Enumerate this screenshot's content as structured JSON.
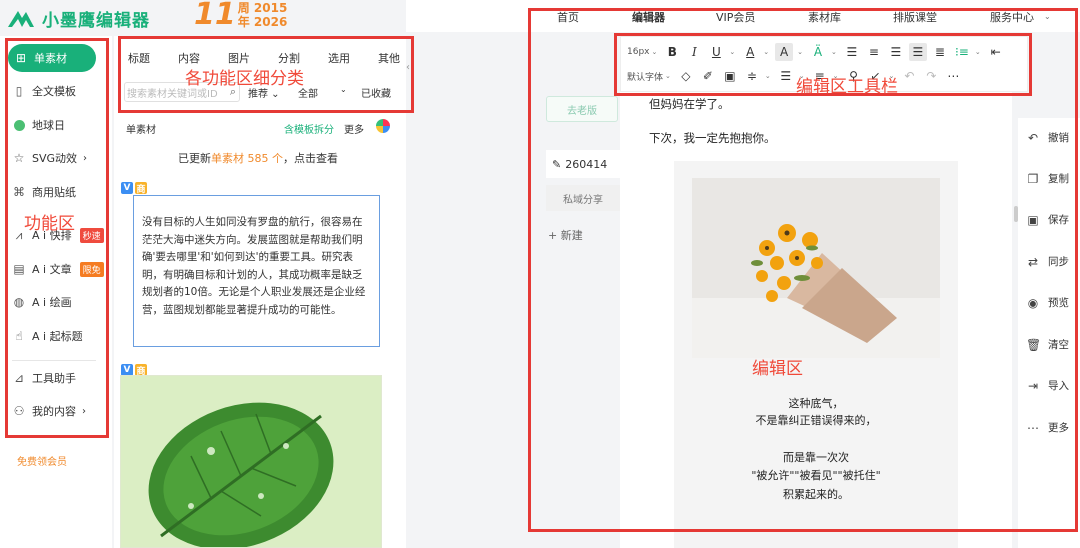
{
  "brand": {
    "name": "小墨鹰编辑器",
    "anniv_num": "11",
    "anniv_line1": "周 2015",
    "anniv_line2": "年 2026"
  },
  "colors": {
    "accent": "#19b07a",
    "annotation": "#e53935",
    "orange": "#f08a2c"
  },
  "leftnav": {
    "items": [
      {
        "label": "单素材",
        "icon": "grid-icon"
      },
      {
        "label": "全文模板",
        "icon": "template-icon"
      },
      {
        "label": "地球日",
        "icon": "earth-icon"
      },
      {
        "label": "SVG动效",
        "icon": "star-icon"
      },
      {
        "label": "商用贴纸",
        "icon": "puzzle-icon"
      },
      {
        "label": "A i 快排",
        "icon": "ai-icon",
        "badge": "秒速"
      },
      {
        "label": "A i 文章",
        "icon": "doc-icon",
        "badge": "限免"
      },
      {
        "label": "A i 绘画",
        "icon": "palette-icon"
      },
      {
        "label": "A i 起标题",
        "icon": "hand-icon"
      },
      {
        "label": "工具助手",
        "icon": "ruler-icon"
      },
      {
        "label": "我的内容",
        "icon": "user-icon"
      }
    ],
    "free_vip": "免费领会员"
  },
  "panel": {
    "tabs": [
      "标题",
      "内容",
      "图片",
      "分割",
      "选用",
      "其他"
    ],
    "search_placeholder": "搜索素材关键词或ID",
    "filter_recommend": "推荐",
    "filter_all": "全部",
    "filter_fav": "已收藏",
    "title": "单素材",
    "link": "含模板拆分",
    "more": "更多",
    "update_prefix": "已更新 ",
    "update_highlight": "单素材 585 个",
    "update_suffix": "，点击查看",
    "card_text": "没有目标的人生如同没有罗盘的航行，很容易在茫茫大海中迷失方向。发展蓝图就是帮助我们明确'要去哪里'和'如何到达'的重要工具。研究表明，有明确目标和计划的人，其成功概率是缺乏规划者的10倍。无论是个人职业发展还是企业经营，蓝图规划都能显著提升成功的可能性。",
    "tag_v": "V",
    "tag_s": "商"
  },
  "topnav": [
    "首页",
    "编辑器",
    "VIP会员",
    "素材库",
    "排版课堂",
    "服务中心"
  ],
  "toolbar": {
    "font_size": "16px",
    "font_family": "默认字体"
  },
  "sidepanel": {
    "history": "去老版",
    "doc_name": "260414",
    "share": "私域分享",
    "new": "新建"
  },
  "editor": {
    "line1": "但妈妈在学了。",
    "line2": "下次，我一定先抱抱你。",
    "poem1": "这种底气，",
    "poem2": "不是靠纠正错误得来的，",
    "poem3": "而是靠一次次",
    "poem4": "\"被允许\"\"被看见\"\"被托住\"",
    "poem5": "积累起来的。"
  },
  "rail": [
    "撤销",
    "复制",
    "保存",
    "同步",
    "预览",
    "清空",
    "导入",
    "更多"
  ],
  "annotations": {
    "func_area": "功能区",
    "sub_area": "各功能区细分类",
    "toolbar_area": "编辑区工具栏",
    "edit_area": "编辑区"
  }
}
